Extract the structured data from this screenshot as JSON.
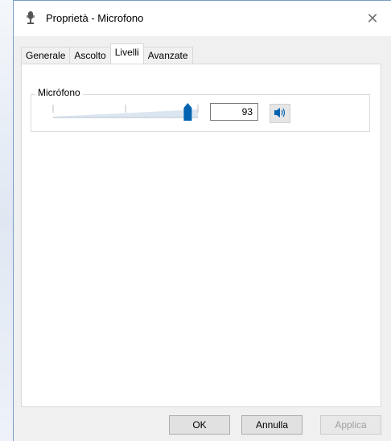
{
  "window": {
    "title": "Proprietà - Microfono",
    "close_symbol": "✕"
  },
  "tabs": [
    {
      "label": "Generale",
      "active": false
    },
    {
      "label": "Ascolto",
      "active": false
    },
    {
      "label": "Livelli",
      "active": true
    },
    {
      "label": "Avanzate",
      "active": false
    }
  ],
  "levels": {
    "group_label": "Micrófono",
    "value": "93",
    "slider_fraction": 0.93
  },
  "buttons": {
    "ok": "OK",
    "cancel": "Annulla",
    "apply": "Applica"
  },
  "icons": {
    "title": "microphone-icon",
    "speaker": "speaker-icon",
    "close": "close-icon"
  },
  "colors": {
    "accent": "#0063b1"
  }
}
